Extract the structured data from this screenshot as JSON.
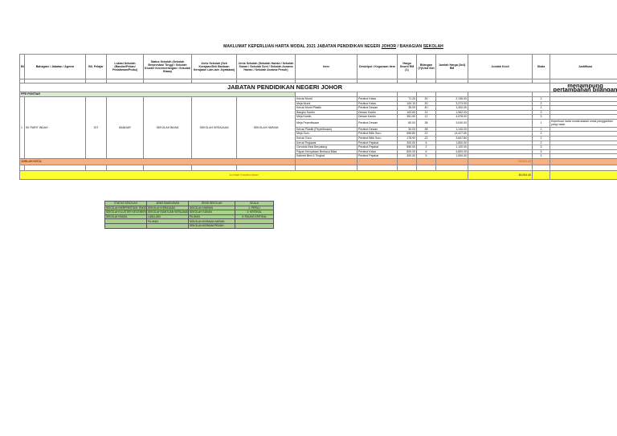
{
  "title": {
    "prefix": "MAKLUMAT KEPERLUAN HARTA MODAL 2021 JABATAN PENDIDIKAN NEGERI ",
    "state": "JOHOR",
    "sep": " / BAHAGIAN ",
    "division": "SEKOLAH"
  },
  "headers": {
    "bil": "Bil.",
    "bahagian": "Bahagian / Jabatan / Agensi",
    "bil_pelajar": "Bil. Pelajar",
    "lokasi": "Lokasi Sekolah (Bandar/Pekan/ Pedalaman/Pulau)",
    "status": "Status Sekolah (Sekolah Berprestasi Tinggi / Sekolah Kluster Kecemerlangan / Sekolah Biasa)",
    "jenis": "Jenis Sekolah (Sek Kerajaan/Sek Bantuan Kerajaan/ Lain-lain -Nyatakan)",
    "jenis_harian": "Jenis Sekolah (Sekolah Harian / Sekolah Sukan / Sekolah Seni / Sekolah Asrama Harian / Sekolah Asrama Penuh)",
    "item": "Item",
    "deskripsi": "Deskripsi / Kegunaan Item",
    "harga": "Harga Seunit RM (1)",
    "bilangan": "Bilangan (Y)/Unit /Set",
    "jumlah_harga": "Jumlah Harga (3x4) RM",
    "jumlah_kecil": "Jumlah Kecil",
    "skala": "Skala",
    "justifikasi": "Justifikasi"
  },
  "jabatan_title": "JABATAN PENDIDIKAN NEGERI JOHOR",
  "ptj_label": "PPD PONTIAN",
  "row_meta": {
    "bil": "1",
    "bahagian": "SK PARIT INDAH",
    "bil_pelajar": "207",
    "lokasi": "BANDAR",
    "status": "SEKOLAH BIASA",
    "jenis": "SEKOLAH KERAJAAN",
    "jenis_harian": "SEKOLAH HARIAN"
  },
  "items": [
    {
      "item": "Kerusi Murid",
      "desc": "Perabot Kelas",
      "harga": "71.20",
      "bil": "30",
      "jumlah": "2,136.00",
      "skala": "2"
    },
    {
      "item": "Meja Murid",
      "desc": "Perabot Kelas",
      "harga": "109.10",
      "bil": "30",
      "jumlah": "3,273.00",
      "skala": "2"
    },
    {
      "item": "Kerusi Murid Plastik",
      "desc": "Perabot Dewan",
      "harga": "35.00",
      "bil": "40",
      "jumlah": "1,400.00",
      "skala": "1"
    },
    {
      "item": "Bangku Kantin",
      "desc": "Dewan Kantin",
      "harga": "163.50",
      "bil": "12",
      "jumlah": "1,962.00",
      "skala": "3"
    },
    {
      "item": "Meja Kantin",
      "desc": "Dewan Kantin",
      "harga": "381.50",
      "bil": "12",
      "jumlah": "4,578.00",
      "skala": "3"
    },
    {
      "item": "Meja Peperiksaan",
      "desc": "Perabot Dewan",
      "harga": "80.00",
      "bil": "38",
      "jumlah": "3,040.00",
      "skala": "1"
    },
    {
      "item": "Kerusi Plastik (Peperiksaan)",
      "desc": "Perabot Dewan",
      "harga": "30.00",
      "bil": "38",
      "jumlah": "1,140.00",
      "skala": "1"
    },
    {
      "item": "Meja Guru",
      "desc": "Perabot Bilik Guru",
      "harga": "655.80",
      "bil": "22",
      "jumlah": "14,427.60",
      "skala": "2"
    },
    {
      "item": "Kerusi Guru",
      "desc": "Perabot Bilik Guru",
      "harga": "176.90",
      "bil": "22",
      "jumlah": "3,847.80",
      "skala": "2"
    },
    {
      "item": "Kerusi Pegawai",
      "desc": "Perabot Pejabat",
      "harga": "300.00",
      "bil": "6",
      "jumlah": "1,800.00",
      "skala": "2"
    },
    {
      "item": "Gerobok Besi Berpalang",
      "desc": "Perabot Pejabat",
      "harga": "550.00",
      "bil": "2",
      "jumlah": "1,100.00",
      "skala": "3"
    },
    {
      "item": "Papan Kenyataan Berkaca Bilas",
      "desc": "Perabot Kelas",
      "harga": "800.00",
      "bil": "6",
      "jumlah": "4,800.00",
      "skala": "3"
    },
    {
      "item": "Kabinet Besi 4 Tingkat",
      "desc": "Perabot Pejabat",
      "harga": "300.00",
      "bil": "5",
      "jumlah": "1,500.00",
      "skala": "3"
    }
  ],
  "justification_top": "menampung pertambahan bilangan",
  "justification_mid": "Keperluan harta modal adalah untuk penggantian yang rosak.",
  "subtotal": {
    "label": "JUMLAH KECIL",
    "amount": "45,004.40"
  },
  "total": {
    "label": "Jumlah Keseluruhan",
    "amount": "45,004.40"
  },
  "legend": {
    "headers": [
      "STATUS SEKOLAH",
      "JENIS BANGUNAN",
      "JENIS SEKOLAH",
      "SKALA"
    ],
    "rows": [
      [
        "SEKOLAH BERPRESTASI TINGGI",
        "SEKOLAH KERAJAAN",
        "SEKOLAH HARIAN",
        "1: PERLU"
      ],
      [
        "SEKOLAH KLUSTER KECEMERLANGAN",
        "SEKOLAH BANTUAN KERAJAAN",
        "SEKOLAH SUKAN",
        "2: KRITIKAL"
      ],
      [
        "SEKOLAH BIASA",
        "LAIN-LAIN",
        "PILIHAN",
        "3: PALING KRITIKAL"
      ],
      [
        "",
        "PILIHAN",
        "SEKOLAH ASRAMA HARIAN",
        ""
      ],
      [
        "",
        "",
        "SEKOLAH ASRAMA PENUH",
        ""
      ]
    ]
  },
  "colors": {
    "subtotal_bg": "#f4b183",
    "total_bg": "#ffff2e",
    "legend_bg": "#a9d18e",
    "ptj_bg": "#d9ead3"
  }
}
